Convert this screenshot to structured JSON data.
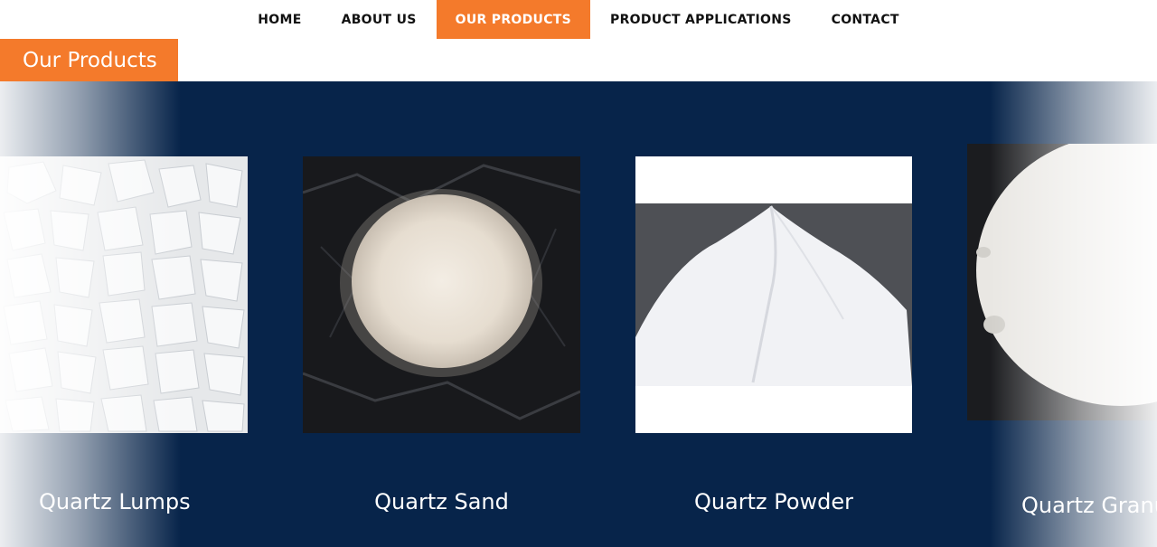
{
  "nav": {
    "items": [
      {
        "label": "HOME"
      },
      {
        "label": "ABOUT US"
      },
      {
        "label": "OUR PRODUCTS",
        "active": true
      },
      {
        "label": "PRODUCT APPLICATIONS"
      },
      {
        "label": "CONTACT"
      }
    ]
  },
  "section": {
    "title": "Our Products"
  },
  "products": [
    {
      "name": "Quartz Lumps"
    },
    {
      "name": "Quartz Sand"
    },
    {
      "name": "Quartz Powder"
    },
    {
      "name": "Quartz Granu"
    }
  ],
  "colors": {
    "accent": "#f47a2b",
    "band": "#07244a"
  }
}
